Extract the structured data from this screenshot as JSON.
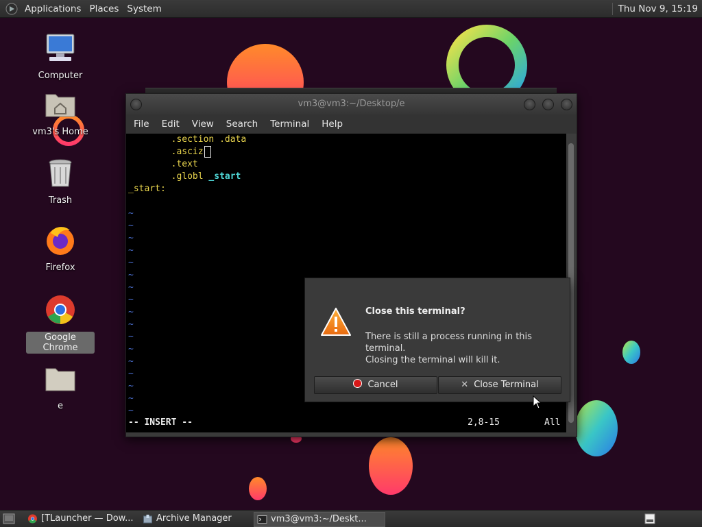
{
  "top_panel": {
    "menus": [
      "Applications",
      "Places",
      "System"
    ],
    "clock": "Thu Nov  9, 15:19"
  },
  "desktop_icons": [
    {
      "label": "Computer",
      "icon": "computer-icon"
    },
    {
      "label": "vm3's Home",
      "icon": "home-folder-icon"
    },
    {
      "label": "Trash",
      "icon": "trash-icon"
    },
    {
      "label": "Firefox",
      "icon": "firefox-icon"
    },
    {
      "label": "Google Chrome",
      "icon": "chrome-icon",
      "selected": true
    },
    {
      "label": "e",
      "icon": "folder-icon"
    }
  ],
  "terminal": {
    "title": "vm3@vm3:~/Desktop/e",
    "menus": [
      "File",
      "Edit",
      "View",
      "Search",
      "Terminal",
      "Help"
    ],
    "lines": [
      {
        "indent": "        ",
        "text": ".section .data"
      },
      {
        "indent": "        ",
        "text": ".asciz"
      },
      {
        "indent": "        ",
        "text": ".text"
      },
      {
        "indent": "        ",
        "text": ".globl ",
        "sym": "_start"
      },
      {
        "indent": "",
        "text": "_start:"
      }
    ],
    "tilde": "~",
    "mode": "-- INSERT --",
    "position": "2,8-15",
    "scroll": "All"
  },
  "dialog": {
    "title": "Close this terminal?",
    "message_line1": "There is still a process running in this terminal.",
    "message_line2": "Closing the terminal will kill it.",
    "cancel_label": "Cancel",
    "close_label": "Close Terminal",
    "close_glyph": "✕"
  },
  "taskbar": {
    "tasks": [
      {
        "label": "[TLauncher — Dow...",
        "icon": "chrome-icon"
      },
      {
        "label": "Archive Manager",
        "icon": "archive-manager-icon"
      },
      {
        "label": "vm3@vm3:~/Deskt...",
        "icon": "terminal-icon",
        "active": true
      }
    ]
  },
  "colors": {
    "background": "#24081f",
    "vim_keyword": "#e8d44d",
    "vim_symbol": "#4fd6d6",
    "vim_tilde": "#4b6fd0",
    "cancel_red": "#d81818"
  }
}
